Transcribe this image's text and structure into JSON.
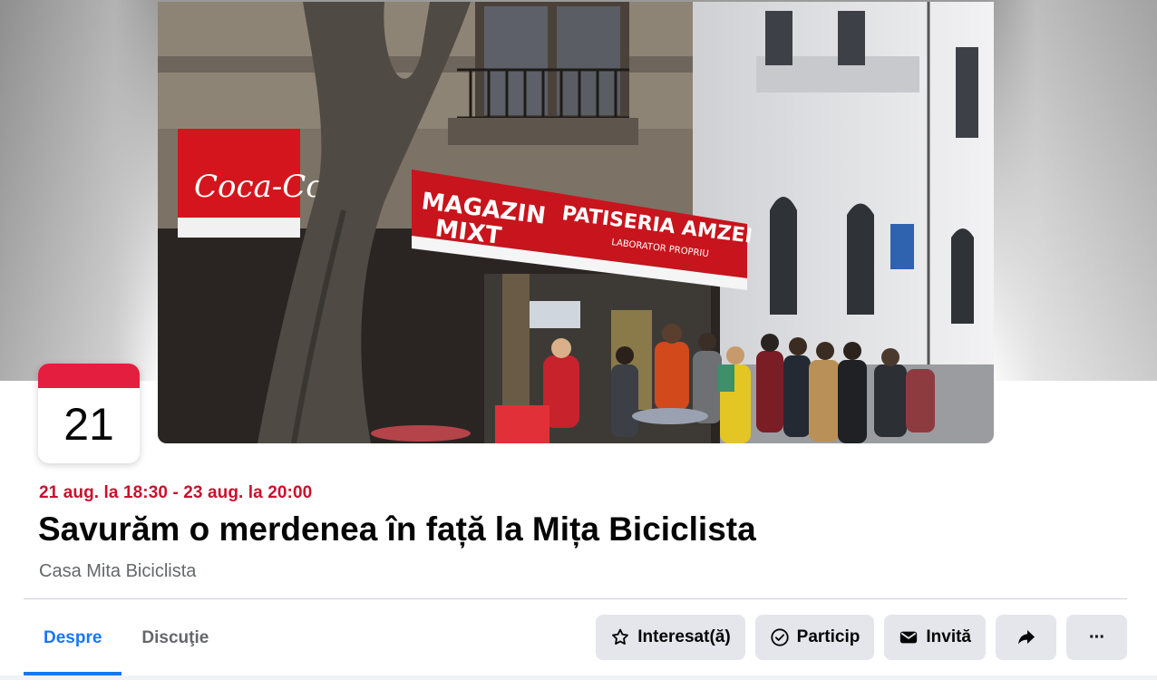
{
  "cover": {
    "signs": {
      "cola": "Coca-Cola",
      "magazin": "MAGAZIN",
      "mixt": "MIXT",
      "patiseria": "PATISERIA AMZEI",
      "laborator": "LABORATOR PROPRIU"
    }
  },
  "date_badge": {
    "day": "21"
  },
  "event": {
    "when": "21 aug. la 18:30 - 23 aug. la 20:00",
    "title": "Savurăm o merdenea în față la Mița Biciclista",
    "host": "Casa Mita Biciclista"
  },
  "tabs": [
    {
      "label": "Despre",
      "active": true
    },
    {
      "label": "Discuţie",
      "active": false
    }
  ],
  "actions": {
    "interested": "Interesat(ă)",
    "going": "Particip",
    "invite": "Invită",
    "share_icon": "share-arrow-icon",
    "more": "···"
  },
  "colors": {
    "accent": "#1877f2",
    "date_red": "#c9102d",
    "badge_red": "#e41e3f",
    "button_bg": "#e4e6eb"
  }
}
